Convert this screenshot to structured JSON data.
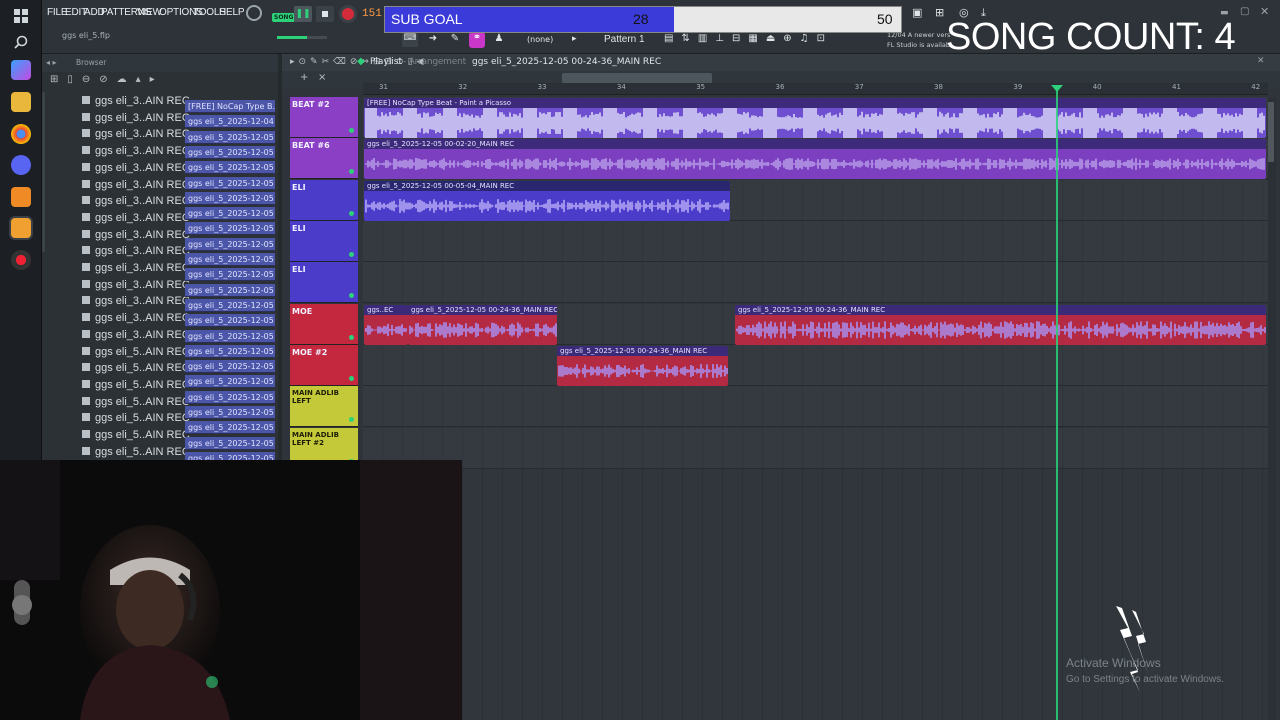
{
  "menu": [
    "FILE",
    "EDIT",
    "ADD",
    "PATTERNS",
    "VIEW",
    "OPTIONS",
    "TOOLS",
    "HELP"
  ],
  "transport": {
    "tempo": "151.0",
    "song_badge": "SONG"
  },
  "project": {
    "file": "ggs eli_5.flp"
  },
  "toolbar2": {
    "pattern": "Pattern 1",
    "snap": "(none)",
    "news": "12/04  A newer vers",
    "news2": "FL Studio is availab"
  },
  "browser": {
    "title": "Browser",
    "files": [
      "ggs eli_3..AIN REC",
      "ggs eli_3..AIN REC",
      "ggs eli_3..AIN REC",
      "ggs eli_3..AIN REC",
      "ggs eli_3..AIN REC",
      "ggs eli_3..AIN REC",
      "ggs eli_3..AIN REC",
      "ggs eli_3..AIN REC",
      "ggs eli_3..AIN REC",
      "ggs eli_3..AIN REC",
      "ggs eli_3..AIN REC",
      "ggs eli_3..AIN REC",
      "ggs eli_3..AIN REC",
      "ggs eli_3..AIN REC",
      "ggs eli_3..AIN REC",
      "ggs eli_5..AIN REC",
      "ggs eli_5..AIN REC",
      "ggs eli_5..AIN REC",
      "ggs eli_5..AIN REC",
      "ggs eli_5..AIN REC",
      "ggs eli_5..AIN REC",
      "ggs eli_5..AIN REC"
    ],
    "patterns": [
      "[FREE] NoCap Type B...",
      "ggs eli_5_2025-12-04 23...",
      "ggs eli_5_2025-12-05 00...",
      "ggs eli_5_2025-12-05 00...",
      "ggs eli_5_2025-12-05 00...",
      "ggs eli_5_2025-12-05 00...",
      "ggs eli_5_2025-12-05 00...",
      "ggs eli_5_2025-12-05 00...",
      "ggs eli_5_2025-12-05 00...",
      "ggs eli_5_2025-12-05 00...",
      "ggs eli_5_2025-12-05 00...",
      "ggs eli_5_2025-12-05 00...",
      "ggs eli_5_2025-12-05 00...",
      "ggs eli_5_2025-12-05 00...",
      "ggs eli_5_2025-12-05 00...",
      "ggs eli_5_2025-12-05 00...",
      "ggs eli_5_2025-12-05 00...",
      "ggs eli_5_2025-12-05 00...",
      "ggs eli_5_2025-12-05 00...",
      "ggs eli_5_2025-12-05 00...",
      "ggs eli_5_2025-12-05 00...",
      "ggs eli_5_2025-12-05 00...",
      "ggs eli_5_2025-12-05 00...",
      "ggs eli_5_2025-12-05 00..."
    ]
  },
  "playlist": {
    "title": "Playlist",
    "subtitle": "Arrangement",
    "clip_name": "ggs eli_5_2025-12-05 00-24-36_MAIN REC",
    "bars": [
      "31",
      "32",
      "33",
      "34",
      "35",
      "36",
      "37",
      "38",
      "39",
      "40",
      "41",
      "42"
    ],
    "tracks": [
      {
        "name": "BEAT #2",
        "color": "#8a3fc4"
      },
      {
        "name": "BEAT #6",
        "color": "#8a3fc4"
      },
      {
        "name": "ELI",
        "color": "#4b3dc9"
      },
      {
        "name": "ELI",
        "color": "#4b3dc9"
      },
      {
        "name": "ELI",
        "color": "#4b3dc9"
      },
      {
        "name": "MOE",
        "color": "#c4283f"
      },
      {
        "name": "MOE #2",
        "color": "#c4283f"
      },
      {
        "name": "MAIN ADLIB LEFT",
        "color": "#c4c93a"
      },
      {
        "name": "MAIN ADLIB LEFT #2",
        "color": "#c4c93a"
      }
    ],
    "clips": [
      {
        "title": "[FREE] NoCap Type Beat - Paint a Picasso"
      },
      {
        "title": "ggs eli_5_2025-12-05 00-02-20_MAIN REC"
      },
      {
        "title": "ggs eli_5_2025-12-05 00-05-04_MAIN REC"
      },
      {
        "title": "ggs..EC"
      },
      {
        "title": "ggs eli_5_2025-12-05 00-24-36_MAIN REC"
      },
      {
        "title": "ggs eli_5_2025-12-05 00-24-36_MAIN REC"
      },
      {
        "title": "ggs eli_5_2025-12-05 00-24-36_MAIN REC"
      }
    ]
  },
  "overlay": {
    "goal_label": "SUB GOAL",
    "goal_current": "28",
    "goal_target": "50",
    "goal_progress": 0.56,
    "song_count": "SONG COUNT: 4"
  },
  "watermark": {
    "line1": "Activate Windows",
    "line2": "Go to Settings to activate Windows."
  },
  "colors": {
    "accent_green": "#2cd17a",
    "clip_purple": "#7a54d6",
    "goal_blue": "#3b3bd9"
  }
}
